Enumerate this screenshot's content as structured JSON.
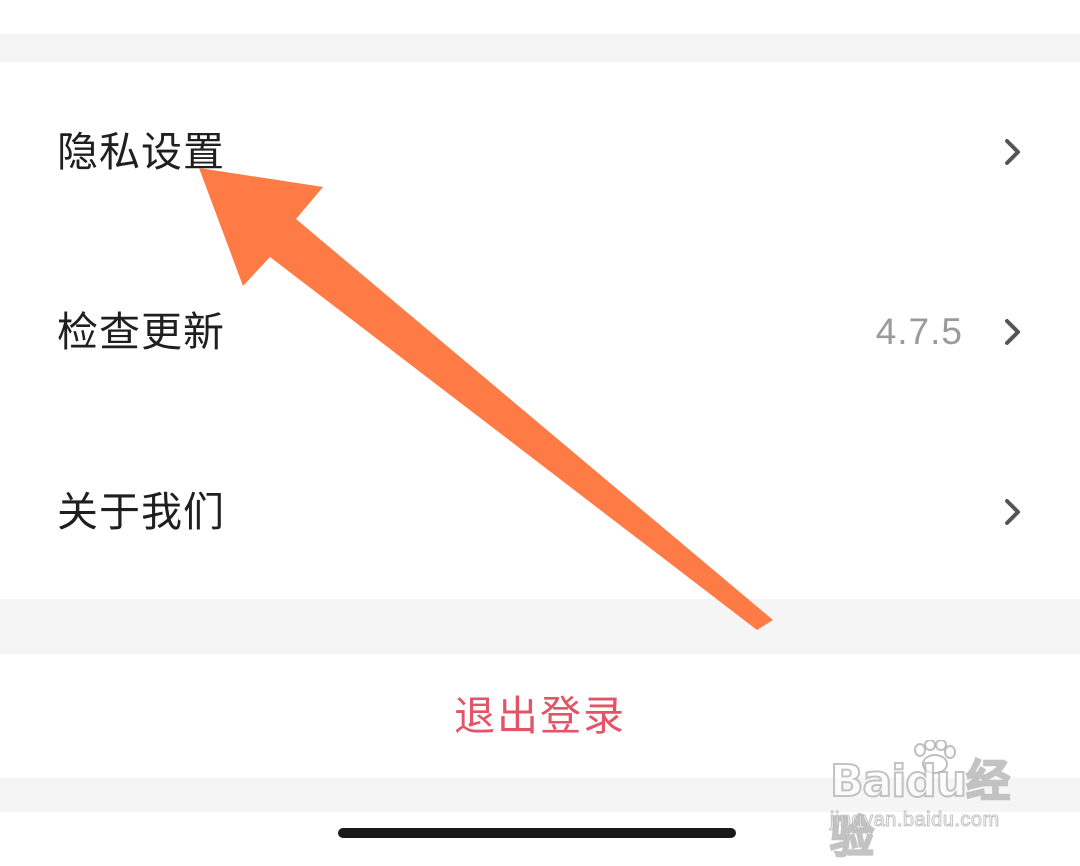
{
  "settings": {
    "items": [
      {
        "label": "隐私设置",
        "value": "",
        "icon": "chevron-right-icon"
      },
      {
        "label": "检查更新",
        "value": "4.7.5",
        "icon": "chevron-right-icon"
      },
      {
        "label": "关于我们",
        "value": "",
        "icon": "chevron-right-icon"
      }
    ]
  },
  "logout": {
    "label": "退出登录"
  },
  "annotation": {
    "icon": "arrow-icon",
    "color": "#ff7b45"
  },
  "watermark": {
    "brand": "Baidu经验",
    "url": "jingyan.baidu.com"
  },
  "colors": {
    "background": "#ffffff",
    "separator": "#f5f5f5",
    "text": "#1f1f1f",
    "secondary_text": "#9a9a9a",
    "logout": "#e35466",
    "chevron": "#555555"
  }
}
